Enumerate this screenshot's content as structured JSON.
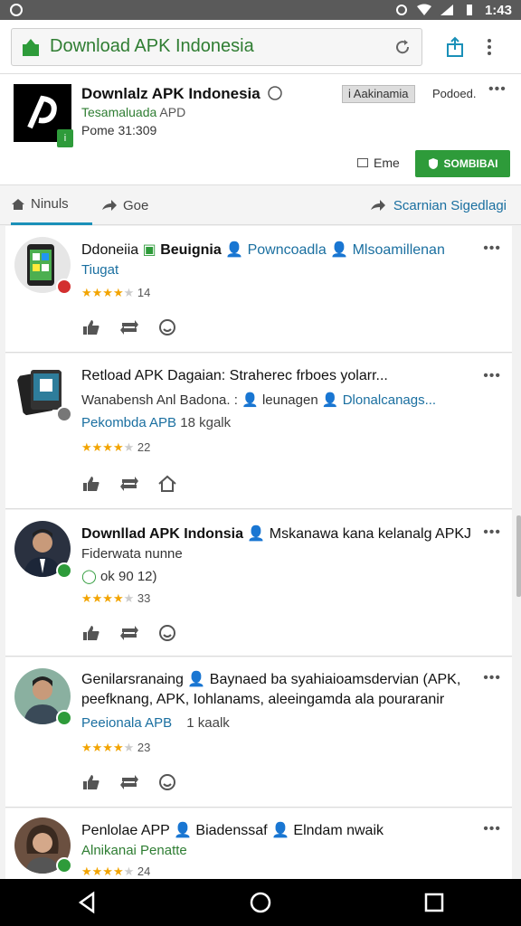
{
  "status": {
    "time": "1:43"
  },
  "urlbar": {
    "url_text": "Download APK Indonesia"
  },
  "header": {
    "title": "Downlalz APK Indonesia",
    "subtitle": "Tesamaluada",
    "subtitle_tag": "APD",
    "meta": "Pome 31:309",
    "pill": "Aakinamia",
    "right_label": "Podoed.",
    "erme": "Eme",
    "action_button": "SOMBIBAI",
    "logo_badge": "i"
  },
  "tabs": [
    {
      "label": "Ninuls"
    },
    {
      "label": "Goe"
    }
  ],
  "tab_right": "Scarnian Sigedlagi",
  "cards": [
    {
      "line1_a": "Ddoneiia",
      "line1_b": "Beuignia",
      "line1_c": "Powncoadla",
      "line1_d": "Mlsoamillenan",
      "line2": "Tiugat",
      "rating": "14"
    },
    {
      "line1": "Retload APK Dagaian: Straherec frboes yolarr...",
      "line2": "Wanabensh Anl Badona. :",
      "line2_b": "leunagen",
      "line2_c": "Dlonalcanags...",
      "line3": "Pekombda APB",
      "line3_b": "18 kgalk",
      "rating": "22"
    },
    {
      "line1": "Downllad APK Indonsia",
      "line1_b": "Mskanawa kana kelanalg APKJ",
      "line2": "Fiderwata nunne",
      "line3": "ok 90",
      "line3_b": "12)",
      "rating": "33"
    },
    {
      "line1": "Genilarsranaing",
      "line1_b": "Baynaed ba syahiaioamsdervian (APK,",
      "line1_c": "peefknang, APK, Iohlanams, aleeingamda ala pouraranir",
      "line3": "Peeionala APB",
      "line3_b": "1 kaalk",
      "rating": "23"
    },
    {
      "line1": "Penlolae APP",
      "line1_b": "Biadenssaf",
      "line1_c": "Elndam nwaik",
      "line2": "Alnikanai Penatte",
      "rating": "24"
    }
  ],
  "colors": {
    "accent_green": "#2e9b3a",
    "link_blue": "#1a6fa0",
    "star": "#f2a400"
  }
}
